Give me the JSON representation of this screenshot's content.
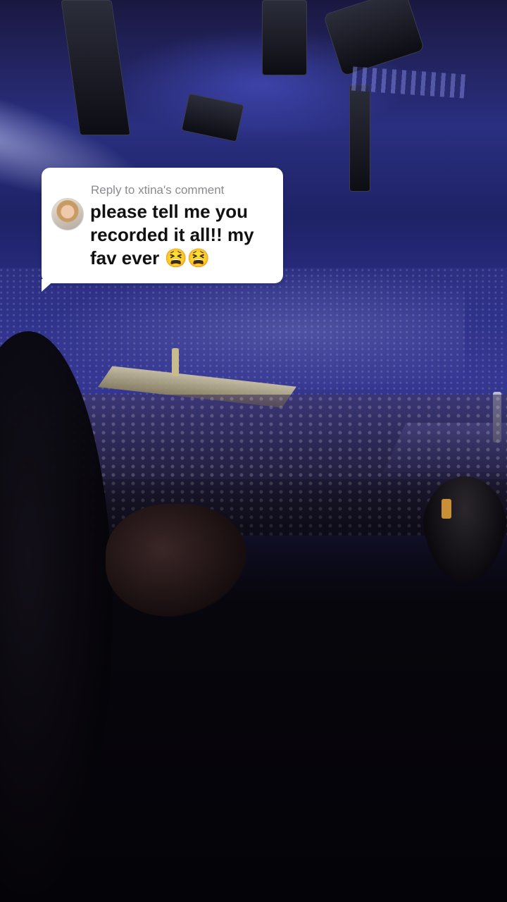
{
  "reply": {
    "prefix": "Reply to xtina's comment",
    "comment": "please tell me you recorded it all!! my fav ever 😫😫",
    "avatar_icon": "user-avatar"
  },
  "colors": {
    "bubble_bg": "#ffffff",
    "comment_text": "#111111",
    "header_text": "#8a8a8f",
    "stage_light": "#3c3fa6"
  }
}
